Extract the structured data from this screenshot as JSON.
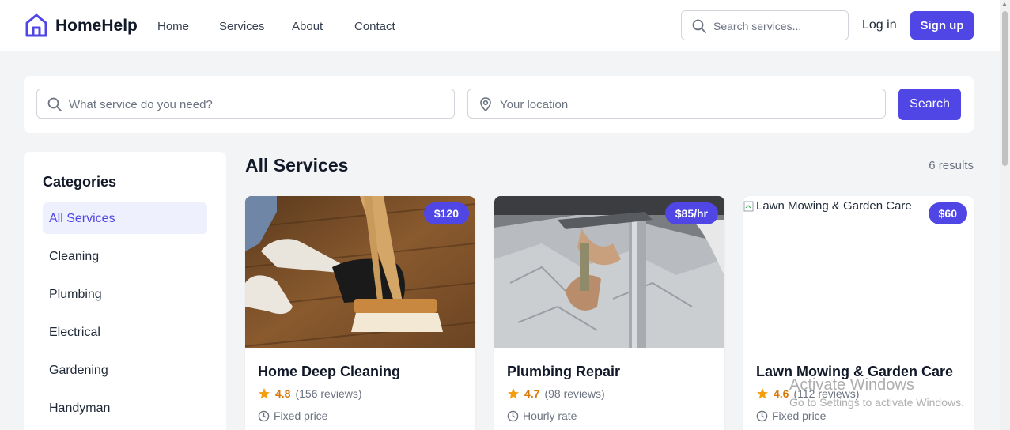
{
  "header": {
    "brand": "HomeHelp",
    "nav": [
      "Home",
      "Services",
      "About",
      "Contact"
    ],
    "search_placeholder": "Search services...",
    "login_label": "Log in",
    "signup_label": "Sign up",
    "brand_color": "#4f46e5"
  },
  "search_panel": {
    "service_placeholder": "What service do you need?",
    "location_placeholder": "Your location",
    "button_label": "Search"
  },
  "sidebar": {
    "title": "Categories",
    "items": [
      "All Services",
      "Cleaning",
      "Plumbing",
      "Electrical",
      "Gardening",
      "Handyman"
    ],
    "active": "All Services"
  },
  "main": {
    "title": "All Services",
    "results": "6 results"
  },
  "cards": [
    {
      "name": "Home Deep Cleaning",
      "price": "$120",
      "rating": "4.8",
      "reviews": "(156 reviews)",
      "price_type": "Fixed price",
      "image": "broom-dustpan-photo"
    },
    {
      "name": "Plumbing Repair",
      "price": "$85/hr",
      "rating": "4.7",
      "reviews": "(98 reviews)",
      "price_type": "Hourly rate",
      "image": "plumber-pipes-photo"
    },
    {
      "name": "Lawn Mowing & Garden Care",
      "price": "$60",
      "rating": "4.6",
      "reviews": "(112 reviews)",
      "price_type": "Fixed price",
      "image_alt": "Lawn Mowing & Garden Care"
    }
  ],
  "os_watermark": {
    "title": "Activate Windows",
    "subtitle": "Go to Settings to activate Windows."
  }
}
